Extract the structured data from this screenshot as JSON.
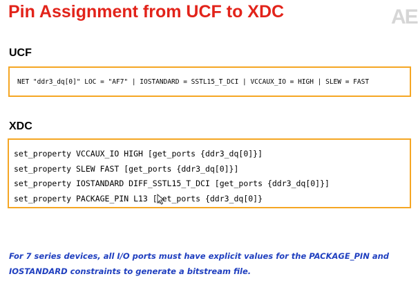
{
  "slide": {
    "title": "Pin Assignment from UCF to XDC",
    "logo": "AE"
  },
  "ucf": {
    "label": "UCF",
    "line": "NET \"ddr3_dq[0]\" LOC = \"AF7\" | IOSTANDARD = SSTL15_T_DCI | VCCAUX_IO = HIGH | SLEW = FAST"
  },
  "xdc": {
    "label": "XDC",
    "lines": [
      "set_property VCCAUX_IO HIGH [get_ports {ddr3_dq[0]}]",
      "set_property SLEW FAST [get_ports {ddr3_dq[0]}]",
      "set_property IOSTANDARD DIFF_SSTL15_T_DCI [get_ports {ddr3_dq[0]}]",
      "set_property PACKAGE_PIN L13 [get_ports {ddr3_dq[0]}"
    ]
  },
  "note": {
    "line1": "For 7 series devices, all I/O ports must have  explicit values for the PACKAGE_PIN and",
    "line2": "IOSTANDARD constraints to generate a bitstream file."
  },
  "colors": {
    "title": "#e2231a",
    "box_border": "#f5a623",
    "note": "#1f3fbf"
  },
  "icons": {
    "cursor": "mouse-pointer-icon"
  }
}
